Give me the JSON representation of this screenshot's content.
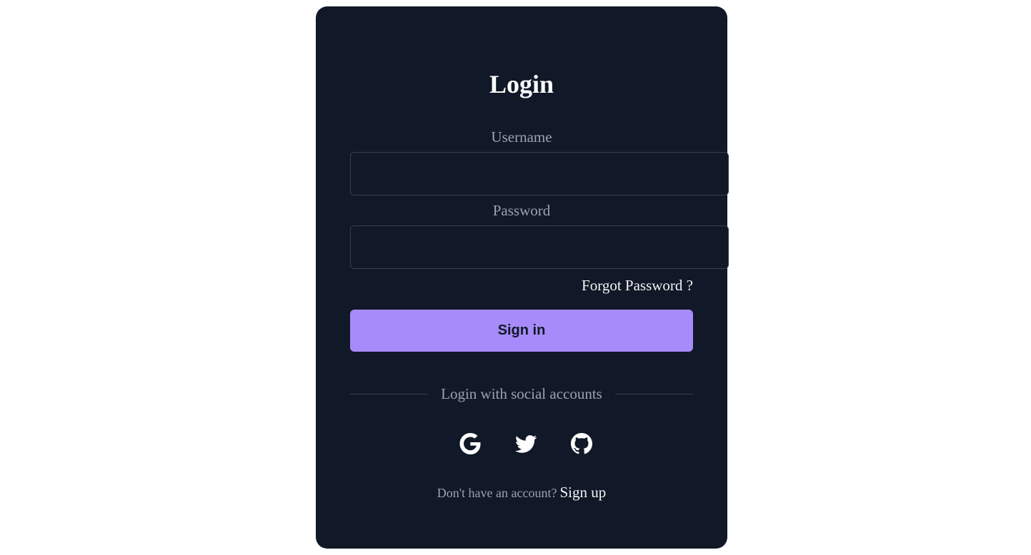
{
  "form": {
    "title": "Login",
    "username_label": "Username",
    "username_value": "",
    "password_label": "Password",
    "password_value": "",
    "forgot_label": "Forgot Password ?",
    "signin_label": "Sign in",
    "social_divider": "Login with social accounts",
    "footer_text": "Don't have an account?",
    "signup_label": "Sign up"
  },
  "social": [
    {
      "icon": "google-icon"
    },
    {
      "icon": "twitter-icon"
    },
    {
      "icon": "github-icon"
    }
  ],
  "colors": {
    "card_bg": "#111827",
    "accent": "#a78bfa",
    "muted_text": "#9ca3af",
    "input_border": "#374151"
  }
}
